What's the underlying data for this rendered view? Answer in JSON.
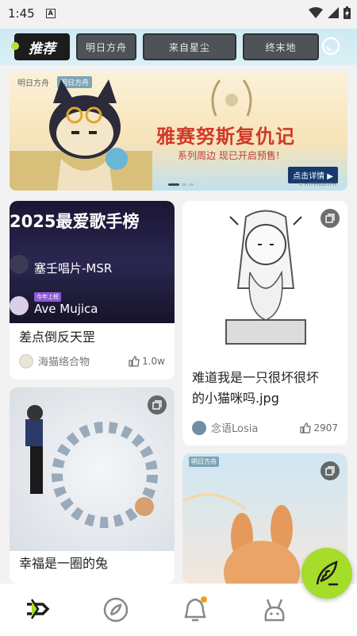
{
  "status_bar": {
    "time": "1:45",
    "notification_letter": "A"
  },
  "tabs": [
    {
      "label": "推荐",
      "active": true
    },
    {
      "label": "明日方舟",
      "active": false
    },
    {
      "label": "来自星尘",
      "active": false
    },
    {
      "label": "终末地",
      "active": false
    }
  ],
  "banner": {
    "tag": "明日方舟",
    "tag2": "明日方舟",
    "title": "雅赛努斯复仇记",
    "subtitle": "系列周边 现已开启预售!",
    "button": "点击详情 ▶",
    "copyright": "© HYPERGRYPH"
  },
  "feed": {
    "left": [
      {
        "title": "差点倒反天罡",
        "image_caption_title": "2025最爱歌手榜",
        "image_row1": "塞壬唱片-MSR",
        "image_row2_badge": "今年上榜",
        "image_row2": "Ave Mujica",
        "author": "海猫络合物",
        "likes": "1.0w"
      },
      {
        "title": "幸福是一圈的兔",
        "author": "",
        "likes": ""
      }
    ],
    "right": [
      {
        "title_line1": "难道我是一只很坏很坏",
        "title_line2": "的小猫咪吗.jpg",
        "author": "念语Losia",
        "likes": "2907"
      },
      {
        "title": "",
        "overlay_tag": "明日方舟"
      }
    ]
  },
  "colors": {
    "accent": "#a6dc2a",
    "dark_tab": "#1c1c1c",
    "notif": "#f29b1f"
  },
  "nav_icons": [
    "home-icon",
    "discover-icon",
    "notification-bell-icon",
    "profile-bunny-icon"
  ],
  "fab_icon": "feather-pen-icon"
}
